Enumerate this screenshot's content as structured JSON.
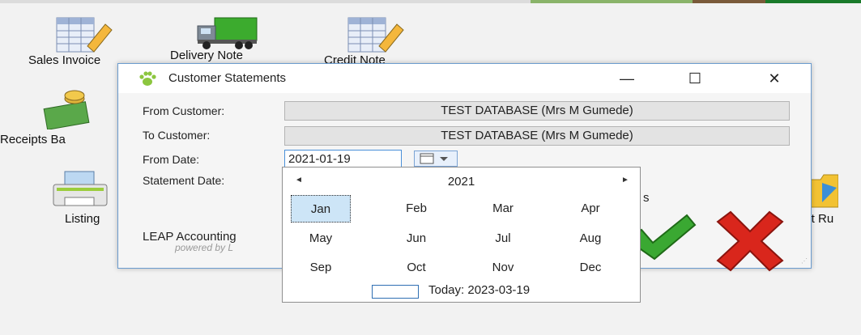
{
  "desktop": {
    "icons": [
      {
        "label": "Sales Invoice"
      },
      {
        "label": "Delivery Note"
      },
      {
        "label": "Credit Note"
      },
      {
        "label": "Receipts Ba"
      },
      {
        "label": "Listing"
      },
      {
        "label": "ent Ru"
      }
    ]
  },
  "dialog": {
    "title": "Customer Statements",
    "controls": {
      "minimize": "—",
      "maximize": "☐",
      "close": "✕"
    },
    "from_customer_label": "From Customer:",
    "from_customer_value": "TEST DATABASE (Mrs M Gumede)",
    "to_customer_label": "To Customer:",
    "to_customer_value": "TEST DATABASE (Mrs M Gumede)",
    "from_date_label": "From Date:",
    "from_date_value": "2021-01-19",
    "statement_date_label": "Statement Date:",
    "brand": "LEAP Accounting",
    "powered": "powered by L",
    "partial_text": "s"
  },
  "calendar": {
    "prev": "◄",
    "next": "►",
    "year": "2021",
    "months": [
      "Jan",
      "Feb",
      "Mar",
      "Apr",
      "May",
      "Jun",
      "Jul",
      "Aug",
      "Sep",
      "Oct",
      "Nov",
      "Dec"
    ],
    "selected": "Jan",
    "today": "Today: 2023-03-19"
  },
  "colors": {
    "accent": "#4a90d9",
    "ok": "#3aa832",
    "cancel": "#d9261c"
  }
}
